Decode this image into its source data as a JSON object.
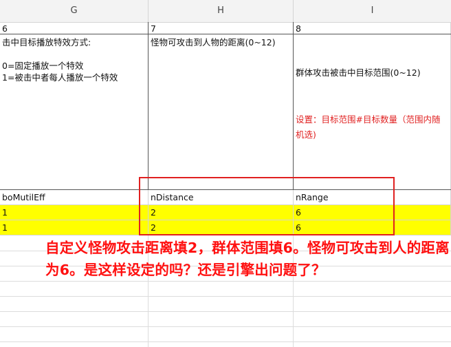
{
  "columns": {
    "g": "G",
    "h": "H",
    "i": "I"
  },
  "row_index": {
    "g": "6",
    "h": "7",
    "i": "8"
  },
  "descriptions": {
    "g": "击中目标播放特效方式:\n\n0=固定播放一个特效\n1=被击中者每人播放一个特效",
    "h": "怪物可攻击到人物的距离(0~12)",
    "i_main": "群体攻击被击中目标范围(0~12)",
    "i_note": "设置：目标范围#目标数量（范围内随机选)"
  },
  "field_names": {
    "g": "boMutilEff",
    "h": "nDistance",
    "i": "nRange"
  },
  "data_rows": [
    {
      "g": "1",
      "h": "2",
      "i": "6"
    },
    {
      "g": "1",
      "h": "2",
      "i": "6"
    }
  ],
  "annotation": "自定义怪物攻击距离填2，群体范围填6。怪物可攻击到人的距离为6。是这样设定的吗？还是引擎出问题了？",
  "colors": {
    "highlight": "#ffff00",
    "annotation": "#ff1010",
    "grid": "#d4d4d4"
  }
}
